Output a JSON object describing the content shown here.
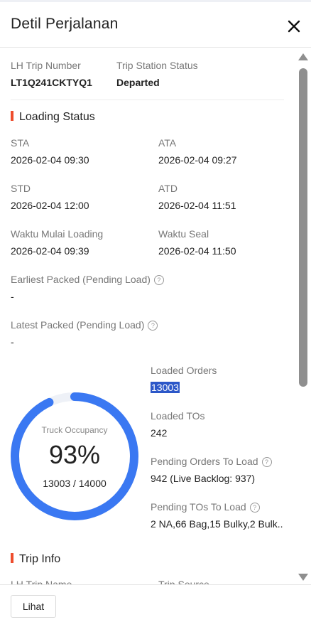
{
  "header": {
    "title": "Detil Perjalanan",
    "close_icon": "close-icon"
  },
  "trip": {
    "lh_trip_number_label": "LH Trip Number",
    "lh_trip_number": "LT1Q241CKTYQ1",
    "station_status_label": "Trip Station Status",
    "station_status": "Departed"
  },
  "loading_status": {
    "title": "Loading Status",
    "sta_label": "STA",
    "sta": "2026-02-04 09:30",
    "ata_label": "ATA",
    "ata": "2026-02-04 09:27",
    "std_label": "STD",
    "std": "2026-02-04 12:00",
    "atd_label": "ATD",
    "atd": "2026-02-04 11:51",
    "start_loading_label": "Waktu Mulai Loading",
    "start_loading": "2026-02-04 09:39",
    "seal_label": "Waktu Seal",
    "seal": "2026-02-04 11:50",
    "earliest_packed_label": "Earliest Packed (Pending Load)",
    "earliest_packed": "-",
    "latest_packed_label": "Latest Packed (Pending Load)",
    "latest_packed": "-",
    "help_glyph": "?"
  },
  "occupancy": {
    "label": "Truck Occupancy",
    "percent_text": "93%",
    "ratio_text": "13003 / 14000",
    "fraction": 0.93,
    "ring_color": "#3a78f2",
    "track_color": "#eef1f7"
  },
  "orders": {
    "loaded_orders_label": "Loaded Orders",
    "loaded_orders": "13003",
    "loaded_tos_label": "Loaded TOs",
    "loaded_tos": "242",
    "pending_orders_label": "Pending Orders To Load",
    "pending_orders": "942 (Live Backlog: 937)",
    "pending_tos_label": "Pending TOs To Load",
    "pending_tos": "2 NA,66 Bag,15 Bulky,2 Bulk..."
  },
  "trip_info": {
    "title": "Trip Info",
    "lh_trip_name_label": "LH Trip Name",
    "trip_source_label": "Trip Source"
  },
  "footer": {
    "view_button": "Lihat"
  },
  "colors": {
    "accent_bar": "#ee4d2d",
    "highlight": "#2c57c8"
  }
}
